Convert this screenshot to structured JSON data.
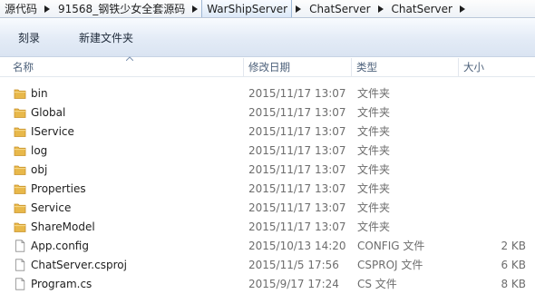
{
  "address_bar": {
    "crumbs": [
      {
        "label": "源代码",
        "highlighted": false
      },
      {
        "label": "91568_钢铁少女全套源码",
        "highlighted": false
      },
      {
        "label": "WarShipServer",
        "highlighted": true
      },
      {
        "label": "ChatServer",
        "highlighted": false
      },
      {
        "label": "ChatServer",
        "highlighted": false
      }
    ]
  },
  "toolbar": {
    "burn_label": "刻录",
    "new_folder_label": "新建文件夹"
  },
  "columns": {
    "name": "名称",
    "date": "修改日期",
    "type": "类型",
    "size": "大小"
  },
  "files": [
    {
      "name": "bin",
      "date": "2015/11/17 13:07",
      "type": "文件夹",
      "size": "",
      "icon": "folder-icon"
    },
    {
      "name": "Global",
      "date": "2015/11/17 13:07",
      "type": "文件夹",
      "size": "",
      "icon": "folder-icon"
    },
    {
      "name": "IService",
      "date": "2015/11/17 13:07",
      "type": "文件夹",
      "size": "",
      "icon": "folder-icon"
    },
    {
      "name": "log",
      "date": "2015/11/17 13:07",
      "type": "文件夹",
      "size": "",
      "icon": "folder-icon"
    },
    {
      "name": "obj",
      "date": "2015/11/17 13:07",
      "type": "文件夹",
      "size": "",
      "icon": "folder-icon"
    },
    {
      "name": "Properties",
      "date": "2015/11/17 13:07",
      "type": "文件夹",
      "size": "",
      "icon": "folder-icon"
    },
    {
      "name": "Service",
      "date": "2015/11/17 13:07",
      "type": "文件夹",
      "size": "",
      "icon": "folder-icon"
    },
    {
      "name": "ShareModel",
      "date": "2015/11/17 13:07",
      "type": "文件夹",
      "size": "",
      "icon": "folder-icon"
    },
    {
      "name": "App.config",
      "date": "2015/10/13 14:20",
      "type": "CONFIG 文件",
      "size": "2 KB",
      "icon": "file-icon"
    },
    {
      "name": "ChatServer.csproj",
      "date": "2015/11/5 17:56",
      "type": "CSPROJ 文件",
      "size": "6 KB",
      "icon": "file-icon"
    },
    {
      "name": "Program.cs",
      "date": "2015/9/17 17:24",
      "type": "CS 文件",
      "size": "8 KB",
      "icon": "file-icon"
    }
  ],
  "colors": {
    "folder": "#e8b84a",
    "accent": "#dbe8f7",
    "secondary_text": "#6d6d6d"
  }
}
